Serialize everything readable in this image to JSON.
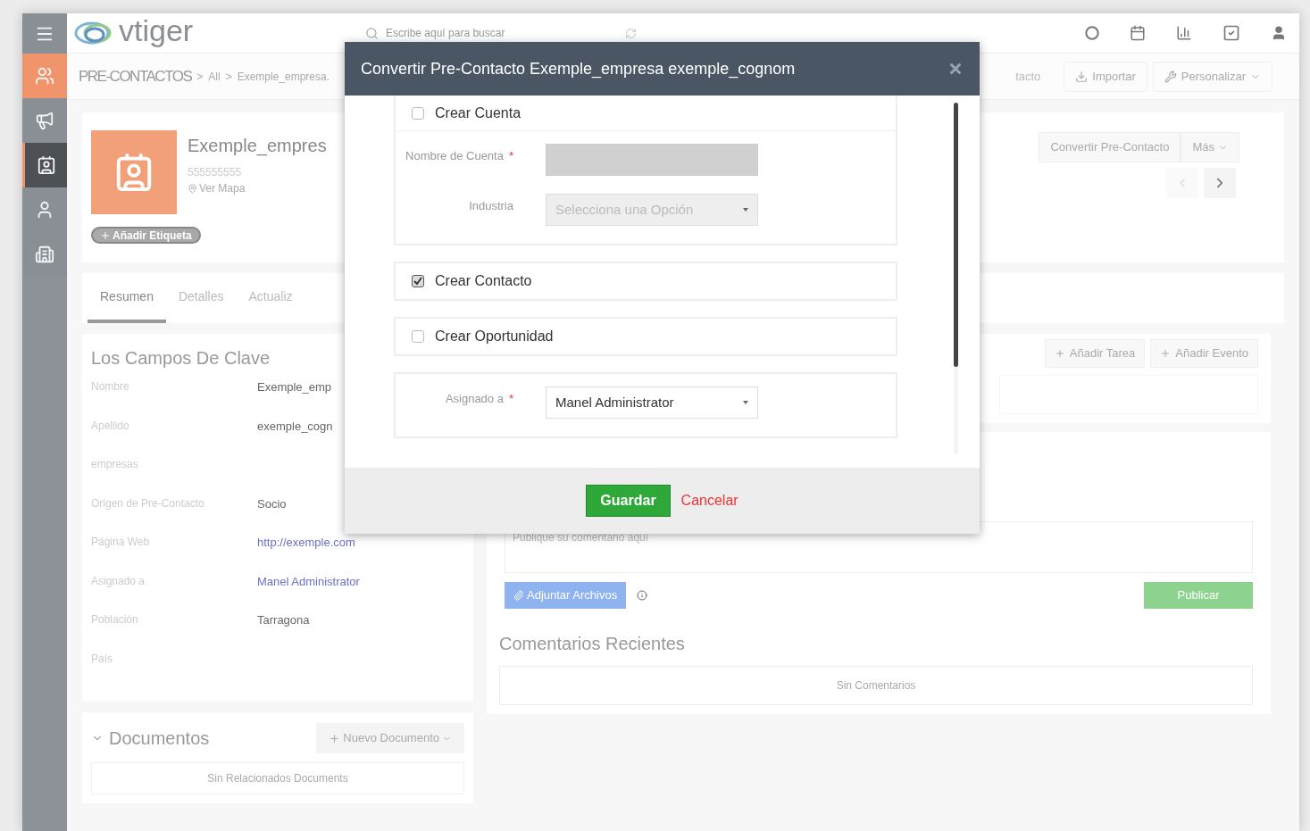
{
  "logo": {
    "text": "vtiger"
  },
  "search": {
    "placeholder": "Escribe aquí para buscar"
  },
  "sidebar": {
    "items": [
      {
        "selected": false,
        "color": "#8a8f96"
      },
      {
        "selected": false,
        "color": "#f0956b"
      },
      {
        "selected": false,
        "color": "#8a8f96"
      },
      {
        "selected": true,
        "color": "#4d5156"
      },
      {
        "selected": false,
        "color": "#8a8f96"
      },
      {
        "selected": false,
        "color": "#8a8f96"
      }
    ]
  },
  "breadcrumb": [
    "PRE-CONTACTOS",
    "All",
    "Exemple_empresa."
  ],
  "breadcrumb_separator": ">",
  "toolbar": {
    "partial_button": "tacto",
    "buttons": [
      "Importar",
      "Personalizar"
    ]
  },
  "record": {
    "name": "Exemple_empres",
    "phone": "555555555",
    "map_link": "Ver Mapa",
    "tag_button": "Añadir Etiqueta",
    "actions": [
      "Convertir Pre-Contacto",
      "Más"
    ]
  },
  "tabs": [
    {
      "label": "Resumen",
      "selected": true
    },
    {
      "label": "Detalles",
      "selected": false
    },
    {
      "label": "Actualiz",
      "selected": false
    }
  ],
  "key_fields": {
    "title": "Los Campos De Clave",
    "rows": [
      {
        "label": "Nombre",
        "value": "Exemple_emp",
        "kind": "text"
      },
      {
        "label": "Apellido",
        "value": "exemple_cogn",
        "kind": "text"
      },
      {
        "label": "empresas"
      },
      {
        "label": "Origen de Pre-Contacto",
        "value": "Socio",
        "kind": "text"
      },
      {
        "label": "Página Web",
        "value": "http://exemple.com",
        "kind": "link"
      },
      {
        "label": "Asignado a",
        "value": "Manel Administrator",
        "kind": "link"
      },
      {
        "label": "Población",
        "value": "Tarragona",
        "kind": "text"
      },
      {
        "label": "País"
      }
    ]
  },
  "documents": {
    "title": "Documentos",
    "add_button": "Nuevo Documento",
    "empty": "Sin Relacionados Documents"
  },
  "activities": {
    "buttons": [
      "Añadir Tarea",
      "Añadir Evento"
    ]
  },
  "comments": {
    "placeholder": "Publique su comentario aquí",
    "attach_button": "Adjuntar Archivos",
    "post_button": "Publicar",
    "recent_title": "Comentarios Recientes",
    "empty": "Sin Comentarios"
  },
  "dialog": {
    "title": "Convertir Pre-Contacto Exemple_empresa exemple_cognom",
    "sections": [
      {
        "label": "Crear Cuenta",
        "checked": false,
        "fields": [
          {
            "label": "Nombre de Cuenta",
            "required_mark": "*",
            "kind": "input",
            "disabled": true
          },
          {
            "label": "Industria",
            "kind": "select",
            "placeholder": "Selecciona una Opción",
            "disabled": true
          }
        ]
      },
      {
        "label": "Crear Contacto",
        "checked": true
      },
      {
        "label": "Crear Oportunidad",
        "checked": false
      },
      {
        "fields": [
          {
            "label": "Asignado a",
            "required_mark": "*",
            "kind": "select",
            "value": "Manel Administrator",
            "disabled": false
          }
        ]
      }
    ],
    "save_button": "Guardar",
    "cancel_button": "Cancelar"
  }
}
